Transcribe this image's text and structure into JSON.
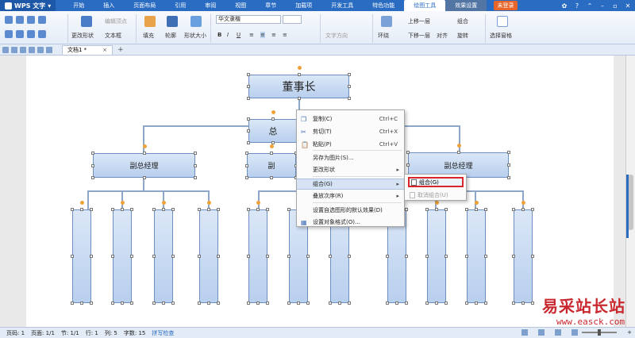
{
  "app": {
    "name": "WPS 文字",
    "login": "未登录"
  },
  "menu_tabs": [
    "开始",
    "插入",
    "页面布局",
    "引用",
    "审阅",
    "视图",
    "章节",
    "加载项",
    "开发工具",
    "特色功能",
    "绘图工具",
    "效果设置"
  ],
  "ribbon": {
    "change_shape": "更改形状",
    "edit_points": "编辑顶点",
    "text_box": "文本框",
    "fill": "填充",
    "outline": "轮廓",
    "shape_size": "形状大小",
    "font_name": "华文隶楷",
    "text_direction": "文字方向",
    "wrap": "环绕",
    "bring_forward": "上移一层",
    "send_backward": "下移一层",
    "align": "对齐",
    "group": "组合",
    "rotate": "旋转",
    "selection_pane": "选择窗格"
  },
  "document_tab": "文档1 *",
  "org_chart": {
    "top": "董事长",
    "middle": "总",
    "left_vp": "副总经理",
    "center_vp": "副",
    "right_vp": "副总经理"
  },
  "context_menu": {
    "items": [
      {
        "label": "复制(C)",
        "shortcut": "Ctrl+C"
      },
      {
        "label": "剪切(T)",
        "shortcut": "Ctrl+X"
      },
      {
        "label": "粘贴(P)",
        "shortcut": "Ctrl+V"
      },
      {
        "label": "另存为图片(S)...",
        "shortcut": ""
      },
      {
        "label": "更改形状",
        "shortcut": ""
      },
      {
        "label": "组合(G)",
        "shortcut": ""
      },
      {
        "label": "叠放次序(R)",
        "shortcut": ""
      },
      {
        "label": "设置自选图形的默认效果(D)",
        "shortcut": ""
      },
      {
        "label": "设置对象格式(O)...",
        "shortcut": ""
      }
    ],
    "submenu": [
      {
        "label": "组合(G)"
      },
      {
        "label": "取消组合(U)"
      }
    ]
  },
  "statusbar": {
    "page": "页码: 1",
    "pages": "页面: 1/1",
    "section": "节: 1/1",
    "row": "行: 1",
    "col": "列: 5",
    "words": "字数: 15",
    "spell": "拼写检查"
  },
  "watermark": {
    "cn": "易采站长站",
    "url": "www.easck.com"
  },
  "colors": {
    "menubar": "#2a6cc2",
    "box_fill": "#b8cfee",
    "box_border": "#6d8fc0",
    "highlight": "#d9262b",
    "accent": "#f0a23a"
  }
}
